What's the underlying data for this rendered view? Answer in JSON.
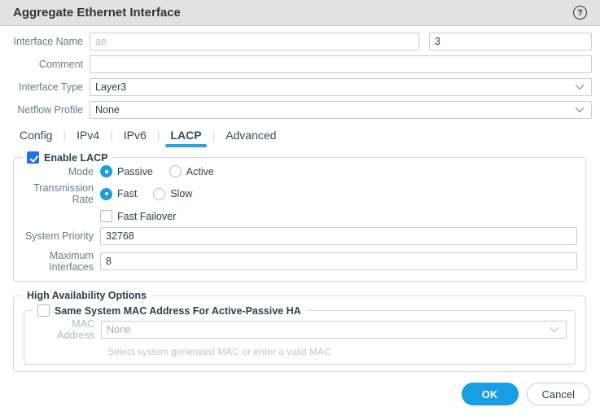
{
  "dialog": {
    "title": "Aggregate Ethernet Interface",
    "help_icon": "?"
  },
  "fields": {
    "interface_name": {
      "label": "Interface Name",
      "placeholder": "ae",
      "number": "3"
    },
    "comment": {
      "label": "Comment",
      "value": ""
    },
    "interface_type": {
      "label": "Interface Type",
      "value": "Layer3"
    },
    "netflow_profile": {
      "label": "Netflow Profile",
      "value": "None"
    }
  },
  "tabs": {
    "items": [
      {
        "label": "Config",
        "active": false
      },
      {
        "label": "IPv4",
        "active": false
      },
      {
        "label": "IPv6",
        "active": false
      },
      {
        "label": "LACP",
        "active": true
      },
      {
        "label": "Advanced",
        "active": false
      }
    ]
  },
  "lacp": {
    "legend": "Enable LACP",
    "enabled": true,
    "mode": {
      "label": "Mode",
      "options": [
        "Passive",
        "Active"
      ],
      "selected": "Passive"
    },
    "transmission_rate": {
      "label": "Transmission Rate",
      "options": [
        "Fast",
        "Slow"
      ],
      "selected": "Fast"
    },
    "fast_failover": {
      "label": "Fast Failover",
      "checked": false
    },
    "system_priority": {
      "label": "System Priority",
      "value": "32768"
    },
    "maximum_interfaces": {
      "label": "Maximum Interfaces",
      "value": "8"
    }
  },
  "high_availability": {
    "legend": "High Availability Options",
    "same_system_mac": {
      "legend": "Same System MAC Address For Active-Passive HA",
      "checked": false
    },
    "mac_address": {
      "label": "MAC Address",
      "value": "None",
      "hint": "Select system generated MAC or enter a valid MAC"
    }
  },
  "footer": {
    "ok": "OK",
    "cancel": "Cancel"
  },
  "colors": {
    "titlebar_bg": "#e2e2e2",
    "accent_blue": "#189ee3",
    "tab_underline_blue": "#2da2dc",
    "checkbox_blue": "#2273e0",
    "radio_blue": "#1b9de0",
    "border_gray": "#d5d9dc",
    "label_gray": "#6d7a85",
    "text_dark": "#333e48",
    "disabled_gray": "#b0b8bf"
  }
}
